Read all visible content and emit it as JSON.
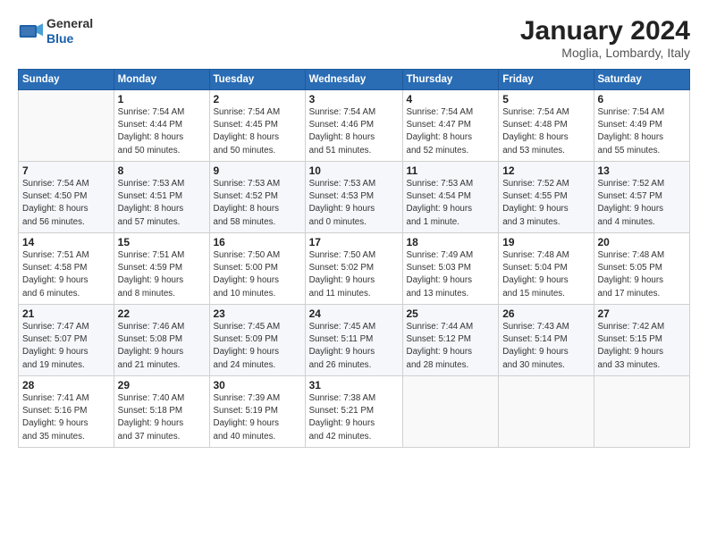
{
  "header": {
    "logo_general": "General",
    "logo_blue": "Blue",
    "month_title": "January 2024",
    "location": "Moglia, Lombardy, Italy"
  },
  "days_of_week": [
    "Sunday",
    "Monday",
    "Tuesday",
    "Wednesday",
    "Thursday",
    "Friday",
    "Saturday"
  ],
  "weeks": [
    [
      {
        "day": "",
        "info": ""
      },
      {
        "day": "1",
        "info": "Sunrise: 7:54 AM\nSunset: 4:44 PM\nDaylight: 8 hours\nand 50 minutes."
      },
      {
        "day": "2",
        "info": "Sunrise: 7:54 AM\nSunset: 4:45 PM\nDaylight: 8 hours\nand 50 minutes."
      },
      {
        "day": "3",
        "info": "Sunrise: 7:54 AM\nSunset: 4:46 PM\nDaylight: 8 hours\nand 51 minutes."
      },
      {
        "day": "4",
        "info": "Sunrise: 7:54 AM\nSunset: 4:47 PM\nDaylight: 8 hours\nand 52 minutes."
      },
      {
        "day": "5",
        "info": "Sunrise: 7:54 AM\nSunset: 4:48 PM\nDaylight: 8 hours\nand 53 minutes."
      },
      {
        "day": "6",
        "info": "Sunrise: 7:54 AM\nSunset: 4:49 PM\nDaylight: 8 hours\nand 55 minutes."
      }
    ],
    [
      {
        "day": "7",
        "info": "Sunrise: 7:54 AM\nSunset: 4:50 PM\nDaylight: 8 hours\nand 56 minutes."
      },
      {
        "day": "8",
        "info": "Sunrise: 7:53 AM\nSunset: 4:51 PM\nDaylight: 8 hours\nand 57 minutes."
      },
      {
        "day": "9",
        "info": "Sunrise: 7:53 AM\nSunset: 4:52 PM\nDaylight: 8 hours\nand 58 minutes."
      },
      {
        "day": "10",
        "info": "Sunrise: 7:53 AM\nSunset: 4:53 PM\nDaylight: 9 hours\nand 0 minutes."
      },
      {
        "day": "11",
        "info": "Sunrise: 7:53 AM\nSunset: 4:54 PM\nDaylight: 9 hours\nand 1 minute."
      },
      {
        "day": "12",
        "info": "Sunrise: 7:52 AM\nSunset: 4:55 PM\nDaylight: 9 hours\nand 3 minutes."
      },
      {
        "day": "13",
        "info": "Sunrise: 7:52 AM\nSunset: 4:57 PM\nDaylight: 9 hours\nand 4 minutes."
      }
    ],
    [
      {
        "day": "14",
        "info": "Sunrise: 7:51 AM\nSunset: 4:58 PM\nDaylight: 9 hours\nand 6 minutes."
      },
      {
        "day": "15",
        "info": "Sunrise: 7:51 AM\nSunset: 4:59 PM\nDaylight: 9 hours\nand 8 minutes."
      },
      {
        "day": "16",
        "info": "Sunrise: 7:50 AM\nSunset: 5:00 PM\nDaylight: 9 hours\nand 10 minutes."
      },
      {
        "day": "17",
        "info": "Sunrise: 7:50 AM\nSunset: 5:02 PM\nDaylight: 9 hours\nand 11 minutes."
      },
      {
        "day": "18",
        "info": "Sunrise: 7:49 AM\nSunset: 5:03 PM\nDaylight: 9 hours\nand 13 minutes."
      },
      {
        "day": "19",
        "info": "Sunrise: 7:48 AM\nSunset: 5:04 PM\nDaylight: 9 hours\nand 15 minutes."
      },
      {
        "day": "20",
        "info": "Sunrise: 7:48 AM\nSunset: 5:05 PM\nDaylight: 9 hours\nand 17 minutes."
      }
    ],
    [
      {
        "day": "21",
        "info": "Sunrise: 7:47 AM\nSunset: 5:07 PM\nDaylight: 9 hours\nand 19 minutes."
      },
      {
        "day": "22",
        "info": "Sunrise: 7:46 AM\nSunset: 5:08 PM\nDaylight: 9 hours\nand 21 minutes."
      },
      {
        "day": "23",
        "info": "Sunrise: 7:45 AM\nSunset: 5:09 PM\nDaylight: 9 hours\nand 24 minutes."
      },
      {
        "day": "24",
        "info": "Sunrise: 7:45 AM\nSunset: 5:11 PM\nDaylight: 9 hours\nand 26 minutes."
      },
      {
        "day": "25",
        "info": "Sunrise: 7:44 AM\nSunset: 5:12 PM\nDaylight: 9 hours\nand 28 minutes."
      },
      {
        "day": "26",
        "info": "Sunrise: 7:43 AM\nSunset: 5:14 PM\nDaylight: 9 hours\nand 30 minutes."
      },
      {
        "day": "27",
        "info": "Sunrise: 7:42 AM\nSunset: 5:15 PM\nDaylight: 9 hours\nand 33 minutes."
      }
    ],
    [
      {
        "day": "28",
        "info": "Sunrise: 7:41 AM\nSunset: 5:16 PM\nDaylight: 9 hours\nand 35 minutes."
      },
      {
        "day": "29",
        "info": "Sunrise: 7:40 AM\nSunset: 5:18 PM\nDaylight: 9 hours\nand 37 minutes."
      },
      {
        "day": "30",
        "info": "Sunrise: 7:39 AM\nSunset: 5:19 PM\nDaylight: 9 hours\nand 40 minutes."
      },
      {
        "day": "31",
        "info": "Sunrise: 7:38 AM\nSunset: 5:21 PM\nDaylight: 9 hours\nand 42 minutes."
      },
      {
        "day": "",
        "info": ""
      },
      {
        "day": "",
        "info": ""
      },
      {
        "day": "",
        "info": ""
      }
    ]
  ]
}
